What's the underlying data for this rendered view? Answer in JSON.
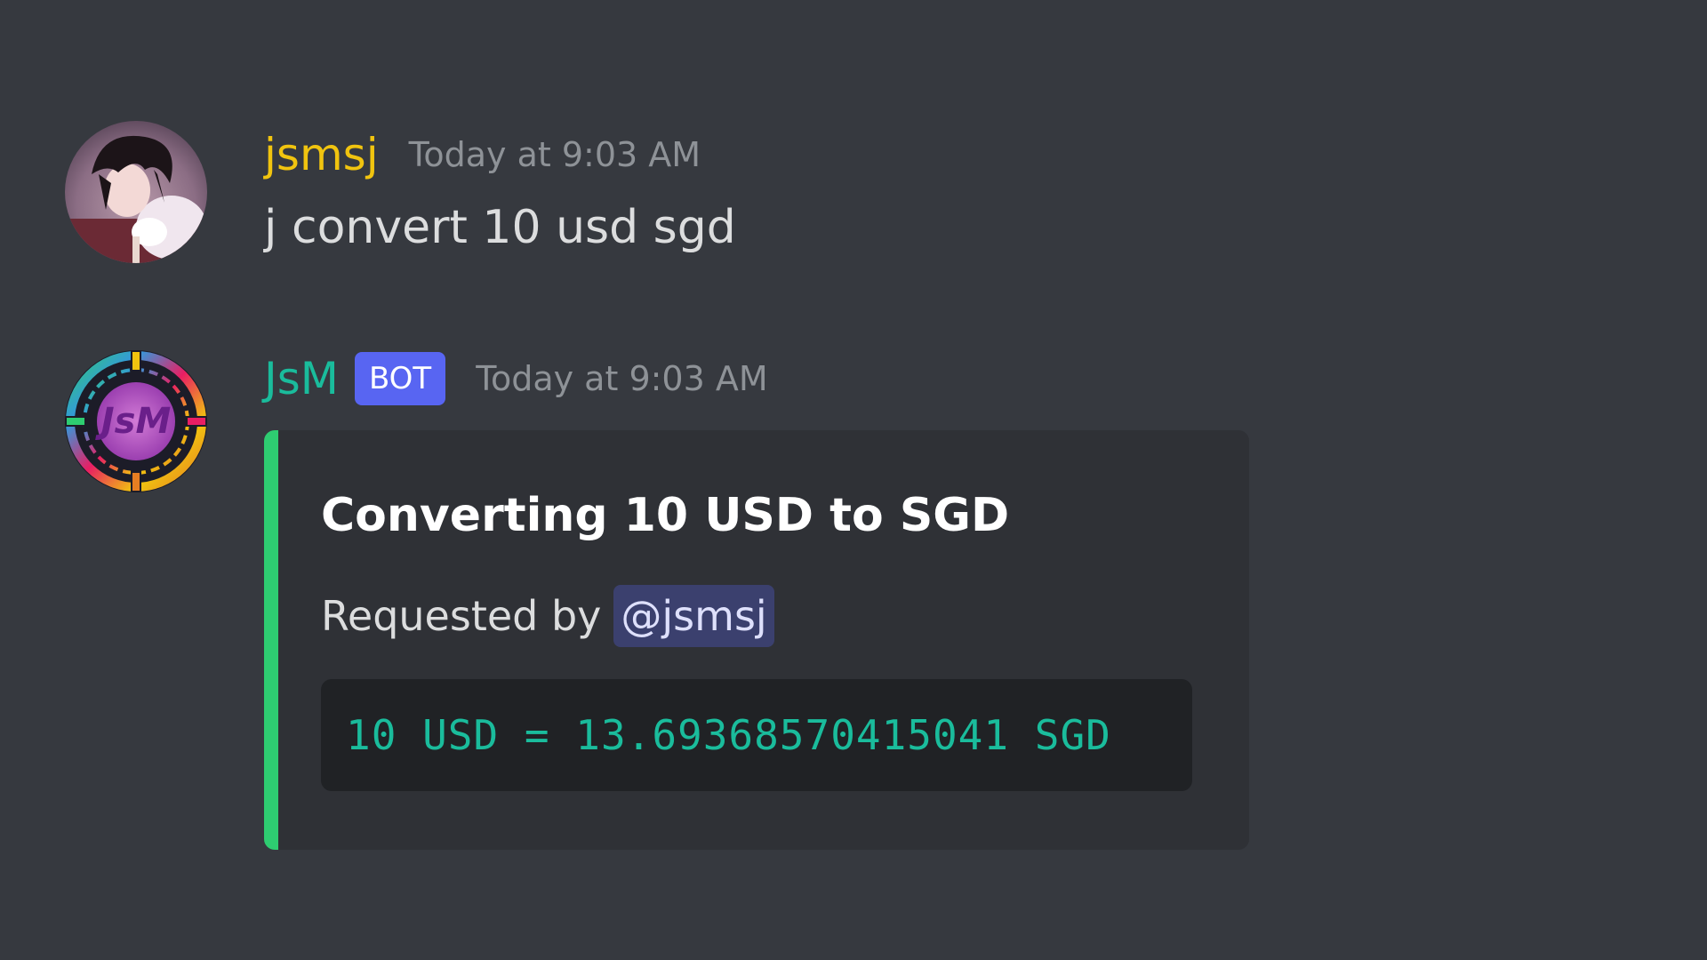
{
  "messages": [
    {
      "author": "jsmsj",
      "author_color": "#f1c40f",
      "timestamp": "Today at 9:03 AM",
      "content": "j convert 10 usd sgd"
    },
    {
      "author": "JsM",
      "author_color": "#1abc9c",
      "bot_tag": "BOT",
      "timestamp": "Today at 9:03 AM",
      "embed": {
        "accent_color": "#2ecc71",
        "title": "Converting 10 USD to SGD",
        "description_prefix": "Requested by",
        "mention": "@jsmsj",
        "code": "10 USD = 13.69368570415041 SGD",
        "code_color": "#1abc9c"
      }
    }
  ],
  "avatars": {
    "user_avatar_icon": "anime-character-avatar",
    "bot_avatar_logo_text": "JsM"
  }
}
